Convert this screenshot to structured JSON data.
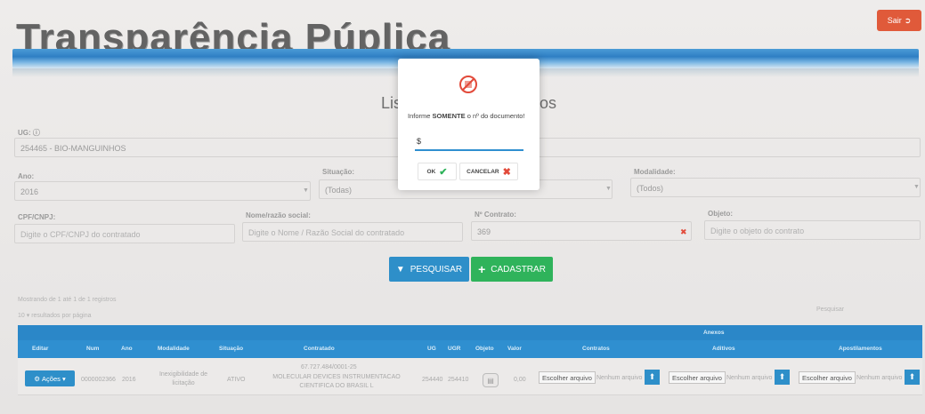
{
  "header": {
    "brand": "Transparência Púplica",
    "logout_label": "Sair",
    "page_title_left": "Lis",
    "page_title_right": "os"
  },
  "filters": {
    "ug_label": "UG:",
    "ug_value": "254465 - BIO-MANGUINHOS",
    "ano_label": "Ano:",
    "ano_value": "2016",
    "situacao_label": "Situação:",
    "situacao_value": "(Todas)",
    "modalidade_label": "Modalidade:",
    "modalidade_value": "(Todos)",
    "cpf_label": "CPF/CNPJ:",
    "cpf_placeholder": "Digite o CPF/CNPJ do contratado",
    "nome_label": "Nome/razão social:",
    "nome_placeholder": "Digite o Nome / Razão Social do contratado",
    "contrato_label": "Nº Contrato:",
    "contrato_value": "369",
    "objeto_label": "Objeto:",
    "objeto_placeholder": "Digite o objeto do contrato"
  },
  "actions": {
    "search_label": "PESQUISAR",
    "add_label": "CADASTRAR"
  },
  "results": {
    "summary": "Mostrando de 1 até 1 de 1 registros",
    "per_page": "10",
    "per_page_suffix": "resultados por página",
    "search_label": "Pesquisar"
  },
  "table": {
    "group_header": "Anexos",
    "columns": [
      "Editar",
      "Num",
      "Ano",
      "Modalidade",
      "Situação",
      "Contratado",
      "UG",
      "UGR",
      "Objeto",
      "Valor",
      "Contratos",
      "Aditivos",
      "Apostilamentos"
    ],
    "row": {
      "acoes_label": "Ações",
      "num": "0000002366",
      "ano": "2016",
      "modalidade": "Inexigibilidade de licitação",
      "situacao": "ATIVO",
      "contratado_doc": "67.727.484/0001-25",
      "contratado_name": "MOLECULAR DEVICES INSTRUMENTACAO CIENTIFICA DO BRASIL L",
      "ug": "254440",
      "ugr": "254410",
      "valor": "0,00",
      "file_button": "Escolher arquivo",
      "file_status": "Nenhum arquivo"
    }
  },
  "modal": {
    "prompt_prefix": "Informe ",
    "prompt_bold": "SOMENTE",
    "prompt_suffix": " o nº do documento!",
    "input_value": "$",
    "ok_label": "OK",
    "cancel_label": "CANCELAR"
  },
  "colors": {
    "primary": "#2e8fc9",
    "success": "#2fb35b",
    "danger": "#e05a3a"
  }
}
